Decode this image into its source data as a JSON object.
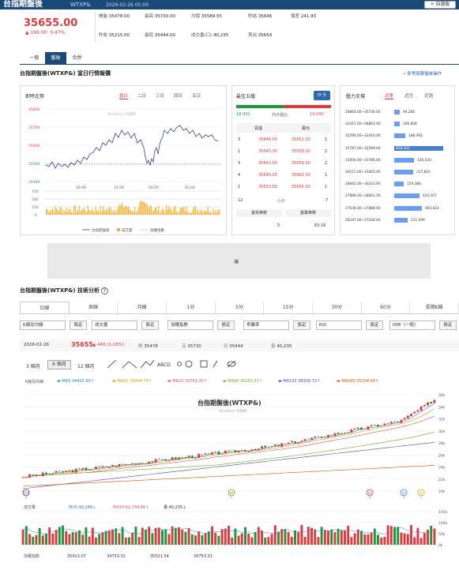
{
  "header": {
    "title": "台指期盤後",
    "symbol": "WTXP&",
    "datetime": "2026-02-26 05:00",
    "add_label": "+ 自選股"
  },
  "quote": {
    "price": "35655.00",
    "change": "▲ 166.00",
    "change_pct": "0.47%",
    "open_label": "開盤",
    "open": "35478.00",
    "high_label": "最高",
    "high": "35730.00",
    "avg_label": "均價",
    "avg": "35589.55",
    "prev_label": "昨收",
    "prev": "35215.00",
    "low_label": "最低",
    "low": "35444.00",
    "vol_label": "成交量(口)",
    "vol": "40,235",
    "settle_label": "昨結",
    "settle": "35646",
    "oi_label": "價差",
    "oi": "241.93",
    "ref_label": "買出",
    "ref": "35654"
  },
  "tabs": [
    "一般",
    "盤後",
    "合併"
  ],
  "section1": {
    "title": "台指期盤後(WTXP&) 當日行情報價",
    "link": "» 參考股票盤後操作"
  },
  "intraday": {
    "title": "即時走勢",
    "tabs": [
      "當日",
      "二日",
      "三日",
      "四日",
      "五日"
    ],
    "watermark": "WantGoo 玩股網",
    "yticks": [
      "35800",
      "35700",
      "35600",
      "35500",
      "35400"
    ],
    "xticks": [
      "18:00",
      "21:00",
      "00:00",
      "03:00"
    ],
    "vticks": [
      "750",
      "500",
      "250",
      "0"
    ],
    "legend": [
      "台指期盤後",
      "成交量",
      "加權指數"
    ]
  },
  "book": {
    "title": "最佳五檔",
    "inner_outer": "內外盤比",
    "buy_vol": "18,931",
    "sell_vol": "19,030",
    "bid_header": "買進",
    "ask_header": "賣出",
    "sum_label": "小計",
    "rows": [
      {
        "bq": "3",
        "bid": "35646.00",
        "ask": "35651.00",
        "aq": "1"
      },
      {
        "bq": "1",
        "bid": "35645.00",
        "ask": "35658.00",
        "aq": "2"
      },
      {
        "bq": "3",
        "bid": "35643.00",
        "ask": "35659.00",
        "aq": "2"
      },
      {
        "bq": "4",
        "bid": "35640.00",
        "ask": "35662.00",
        "aq": "1"
      },
      {
        "bq": "1",
        "bid": "35633.00",
        "ask": "35665.00",
        "aq": "1"
      }
    ],
    "bid_sum": "12",
    "ask_sum": "7",
    "bid_count_label": "委買筆數",
    "ask_count_label": "委賣筆數",
    "bid_count": "5",
    "ask_count": "63.16"
  },
  "pressure": {
    "title": "壓力支撐",
    "tabs": [
      "近季",
      "近月",
      "近週"
    ],
    "rows": [
      {
        "range": "34864.00~35730.00",
        "value": "94,284",
        "frac": 0.11
      },
      {
        "range": "33411.00~34863.00",
        "value": "100,858",
        "frac": 0.12
      },
      {
        "range": "32590.00~33410.00",
        "value": "188,492",
        "frac": 0.23
      },
      {
        "range": "31787.00~32589.00",
        "value": "828,101",
        "frac": 1.0
      },
      {
        "range": "31004.00~31786.00",
        "value": "336,530",
        "frac": 0.41
      },
      {
        "range": "30211.00~31003.00",
        "value": "317,810",
        "frac": 0.38
      },
      {
        "range": "28662.00~30210.00",
        "value": "159,388",
        "frac": 0.19
      },
      {
        "range": "27889.00~28661.00",
        "value": "424,107",
        "frac": 0.51
      },
      {
        "range": "27039.00~27888.00",
        "value": "465,022",
        "frac": 0.56
      },
      {
        "range": "26247.00~27038.00",
        "value": "231,599",
        "frac": 0.28
      }
    ]
  },
  "section2": {
    "title": "台指期盤後(WTXP&) 技術分析"
  },
  "periods": [
    "日線",
    "周線",
    "月線",
    "1分",
    "5分",
    "15分",
    "30分",
    "60分",
    "長期K線"
  ],
  "controls": {
    "k": "K線及均線",
    "set": "設定",
    "vol": "成交量",
    "ind": "加權指數",
    "bias": "乖離率",
    "rsi": "RSI",
    "dmi": "DMI（一般）"
  },
  "kinfo": {
    "date": "2026-02-26",
    "close": "35655",
    "chg": "▲ 440 (1.26%)",
    "open_lbl": "開",
    "open": "35478",
    "high_lbl": "高",
    "high": "35730",
    "low_lbl": "低",
    "low": "35444",
    "vol_lbl": "量",
    "vol": "40,235"
  },
  "ranges": [
    "3 個月",
    "6 個月",
    "12 個月"
  ],
  "ma": {
    "label": "K線及均線",
    "ma5": "MA5 34425.60↑",
    "ma10": "MA10 33344.79↑",
    "ma20": "MA20 32761.35↑",
    "ma60": "MA60 30155.57↑",
    "ma120": "MA120 28309.72↑",
    "ma240": "MA240 25104.56↑"
  },
  "kchart": {
    "title": "台指期盤後(WTXP&)",
    "watermark": "WantGoo 玩股網",
    "yticks": [
      "36k",
      "34k",
      "32k",
      "30k",
      "28k",
      "26k",
      "24k",
      "22k",
      "20k"
    ],
    "markers": [
      "123",
      "89",
      "22",
      "10",
      "5"
    ]
  },
  "volpanel": {
    "label": "成交量",
    "mv5": "MV5 49,288↓",
    "mv20": "MV20 62,744.86↑",
    "v": "量 40,235↓",
    "yticks": [
      "150k",
      "100k",
      "50k",
      "0k"
    ]
  },
  "idxpanel": {
    "label": "加權指數",
    "v1": "35413.07",
    "v2": "34753.31",
    "v3": "35521.54",
    "v4": "34753.31"
  },
  "colors": {
    "up": "#e03a3e",
    "down": "#1a9a3a",
    "brand": "#1a4a78",
    "accent": "#2a6ab0"
  }
}
